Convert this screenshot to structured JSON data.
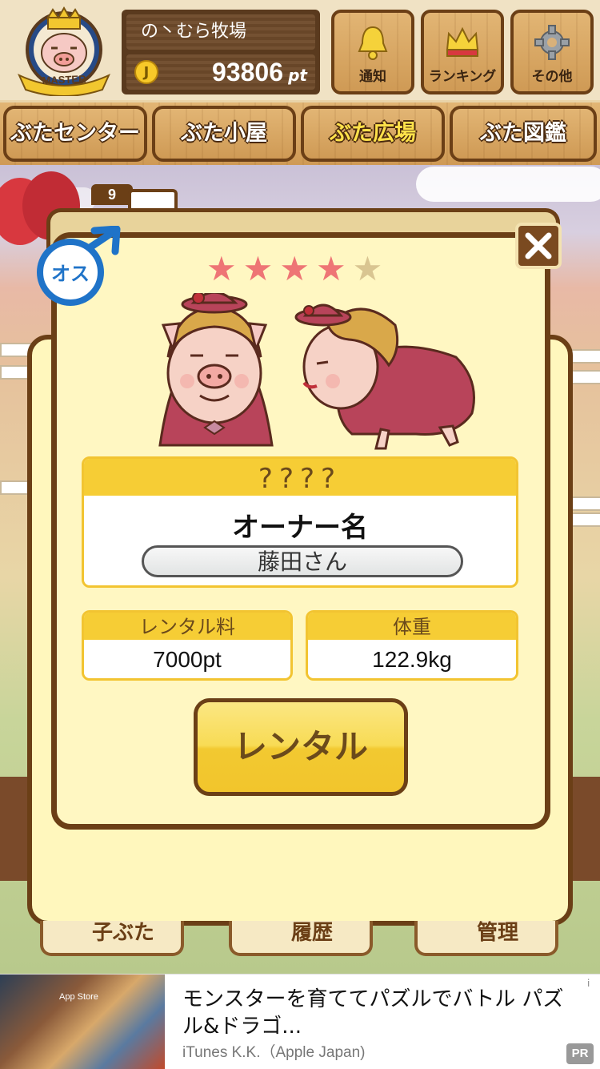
{
  "header": {
    "badge_text": "MASTER",
    "farm_name": "の丶むら牧場",
    "points": "93806",
    "points_unit": "pt",
    "coin_symbol": "J",
    "buttons": [
      {
        "label": "通知",
        "icon": "bell-icon"
      },
      {
        "label": "ランキング",
        "icon": "crown-icon"
      },
      {
        "label": "その他",
        "icon": "gear-icon"
      }
    ]
  },
  "nav": {
    "tabs": [
      {
        "label": "ぶたセンター",
        "active": false
      },
      {
        "label": "ぶた小屋",
        "active": false
      },
      {
        "label": "ぶた広場",
        "active": true
      },
      {
        "label": "ぶた図鑑",
        "active": false
      }
    ]
  },
  "back_tab_count": "9",
  "modal": {
    "gender_label": "オス",
    "rating": {
      "value": 4,
      "max": 5
    },
    "pig_name": "????",
    "owner_label": "オーナー名",
    "owner_name": "藤田さん",
    "rental_fee_label": "レンタル料",
    "rental_fee_value": "7000pt",
    "weight_label": "体重",
    "weight_value": "122.9kg",
    "rent_button": "レンタル"
  },
  "bottom_menu": {
    "items": [
      {
        "label": "子ぶた"
      },
      {
        "label": "履歴"
      },
      {
        "label": "管理"
      }
    ]
  },
  "ad": {
    "image_caption": "App Store",
    "title": "モンスターを育ててパズルでバトル パズル&ドラゴ...",
    "publisher": "iTunes K.K.（Apple Japan)",
    "pr_badge": "PR",
    "info_icon": "i"
  },
  "colors": {
    "wood_border": "#6b3f16",
    "modal_bg": "#fff7c2",
    "accent_yellow": "#f6cd35",
    "star_on": "#ee7575",
    "star_off": "#d9c591",
    "gender_blue": "#1f73c8",
    "active_tab_text": "#ffe14a"
  }
}
